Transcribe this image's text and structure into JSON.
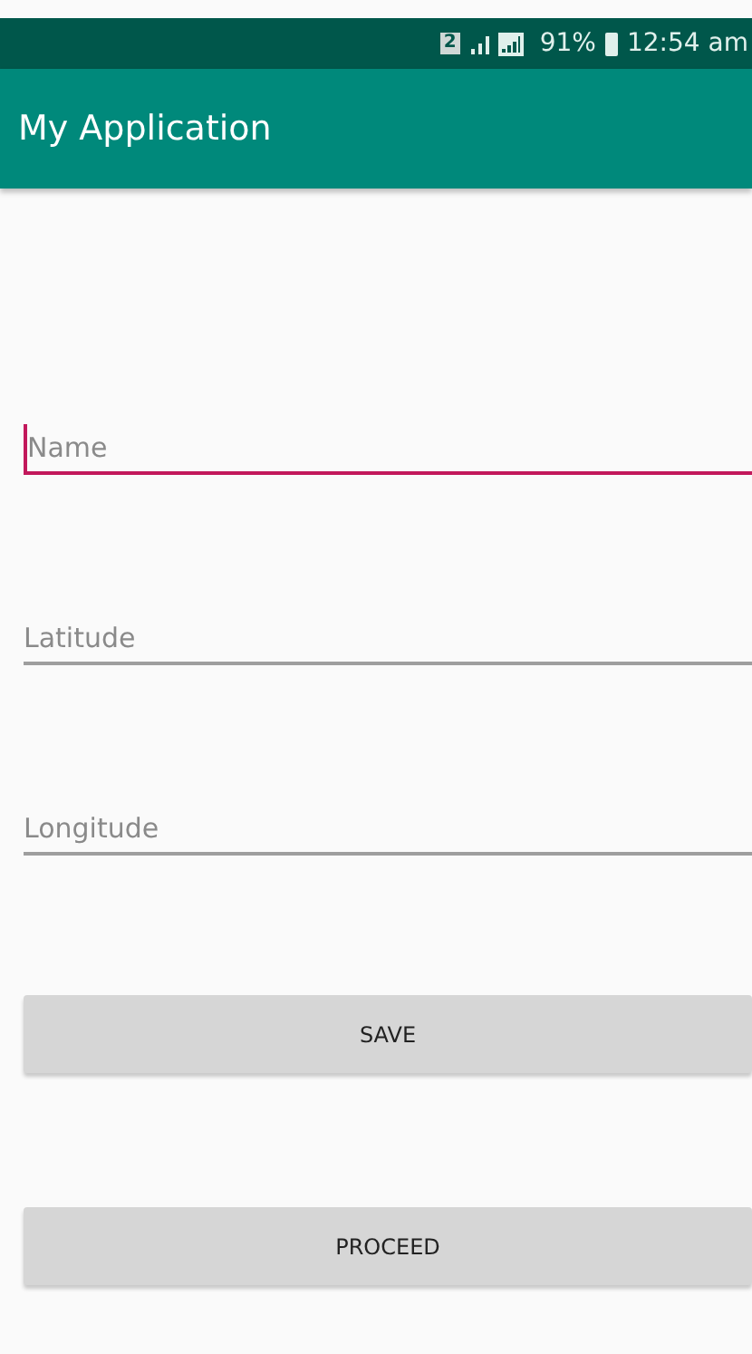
{
  "status_bar": {
    "sim": "2",
    "battery": "91%",
    "time": "12:54 am"
  },
  "app_bar": {
    "title": "My Application"
  },
  "fields": [
    {
      "placeholder": "Name",
      "focused": true
    },
    {
      "placeholder": "Latitude",
      "focused": false
    },
    {
      "placeholder": "Longitude",
      "focused": false
    }
  ],
  "buttons": [
    "SAVE",
    "PROCEED"
  ]
}
